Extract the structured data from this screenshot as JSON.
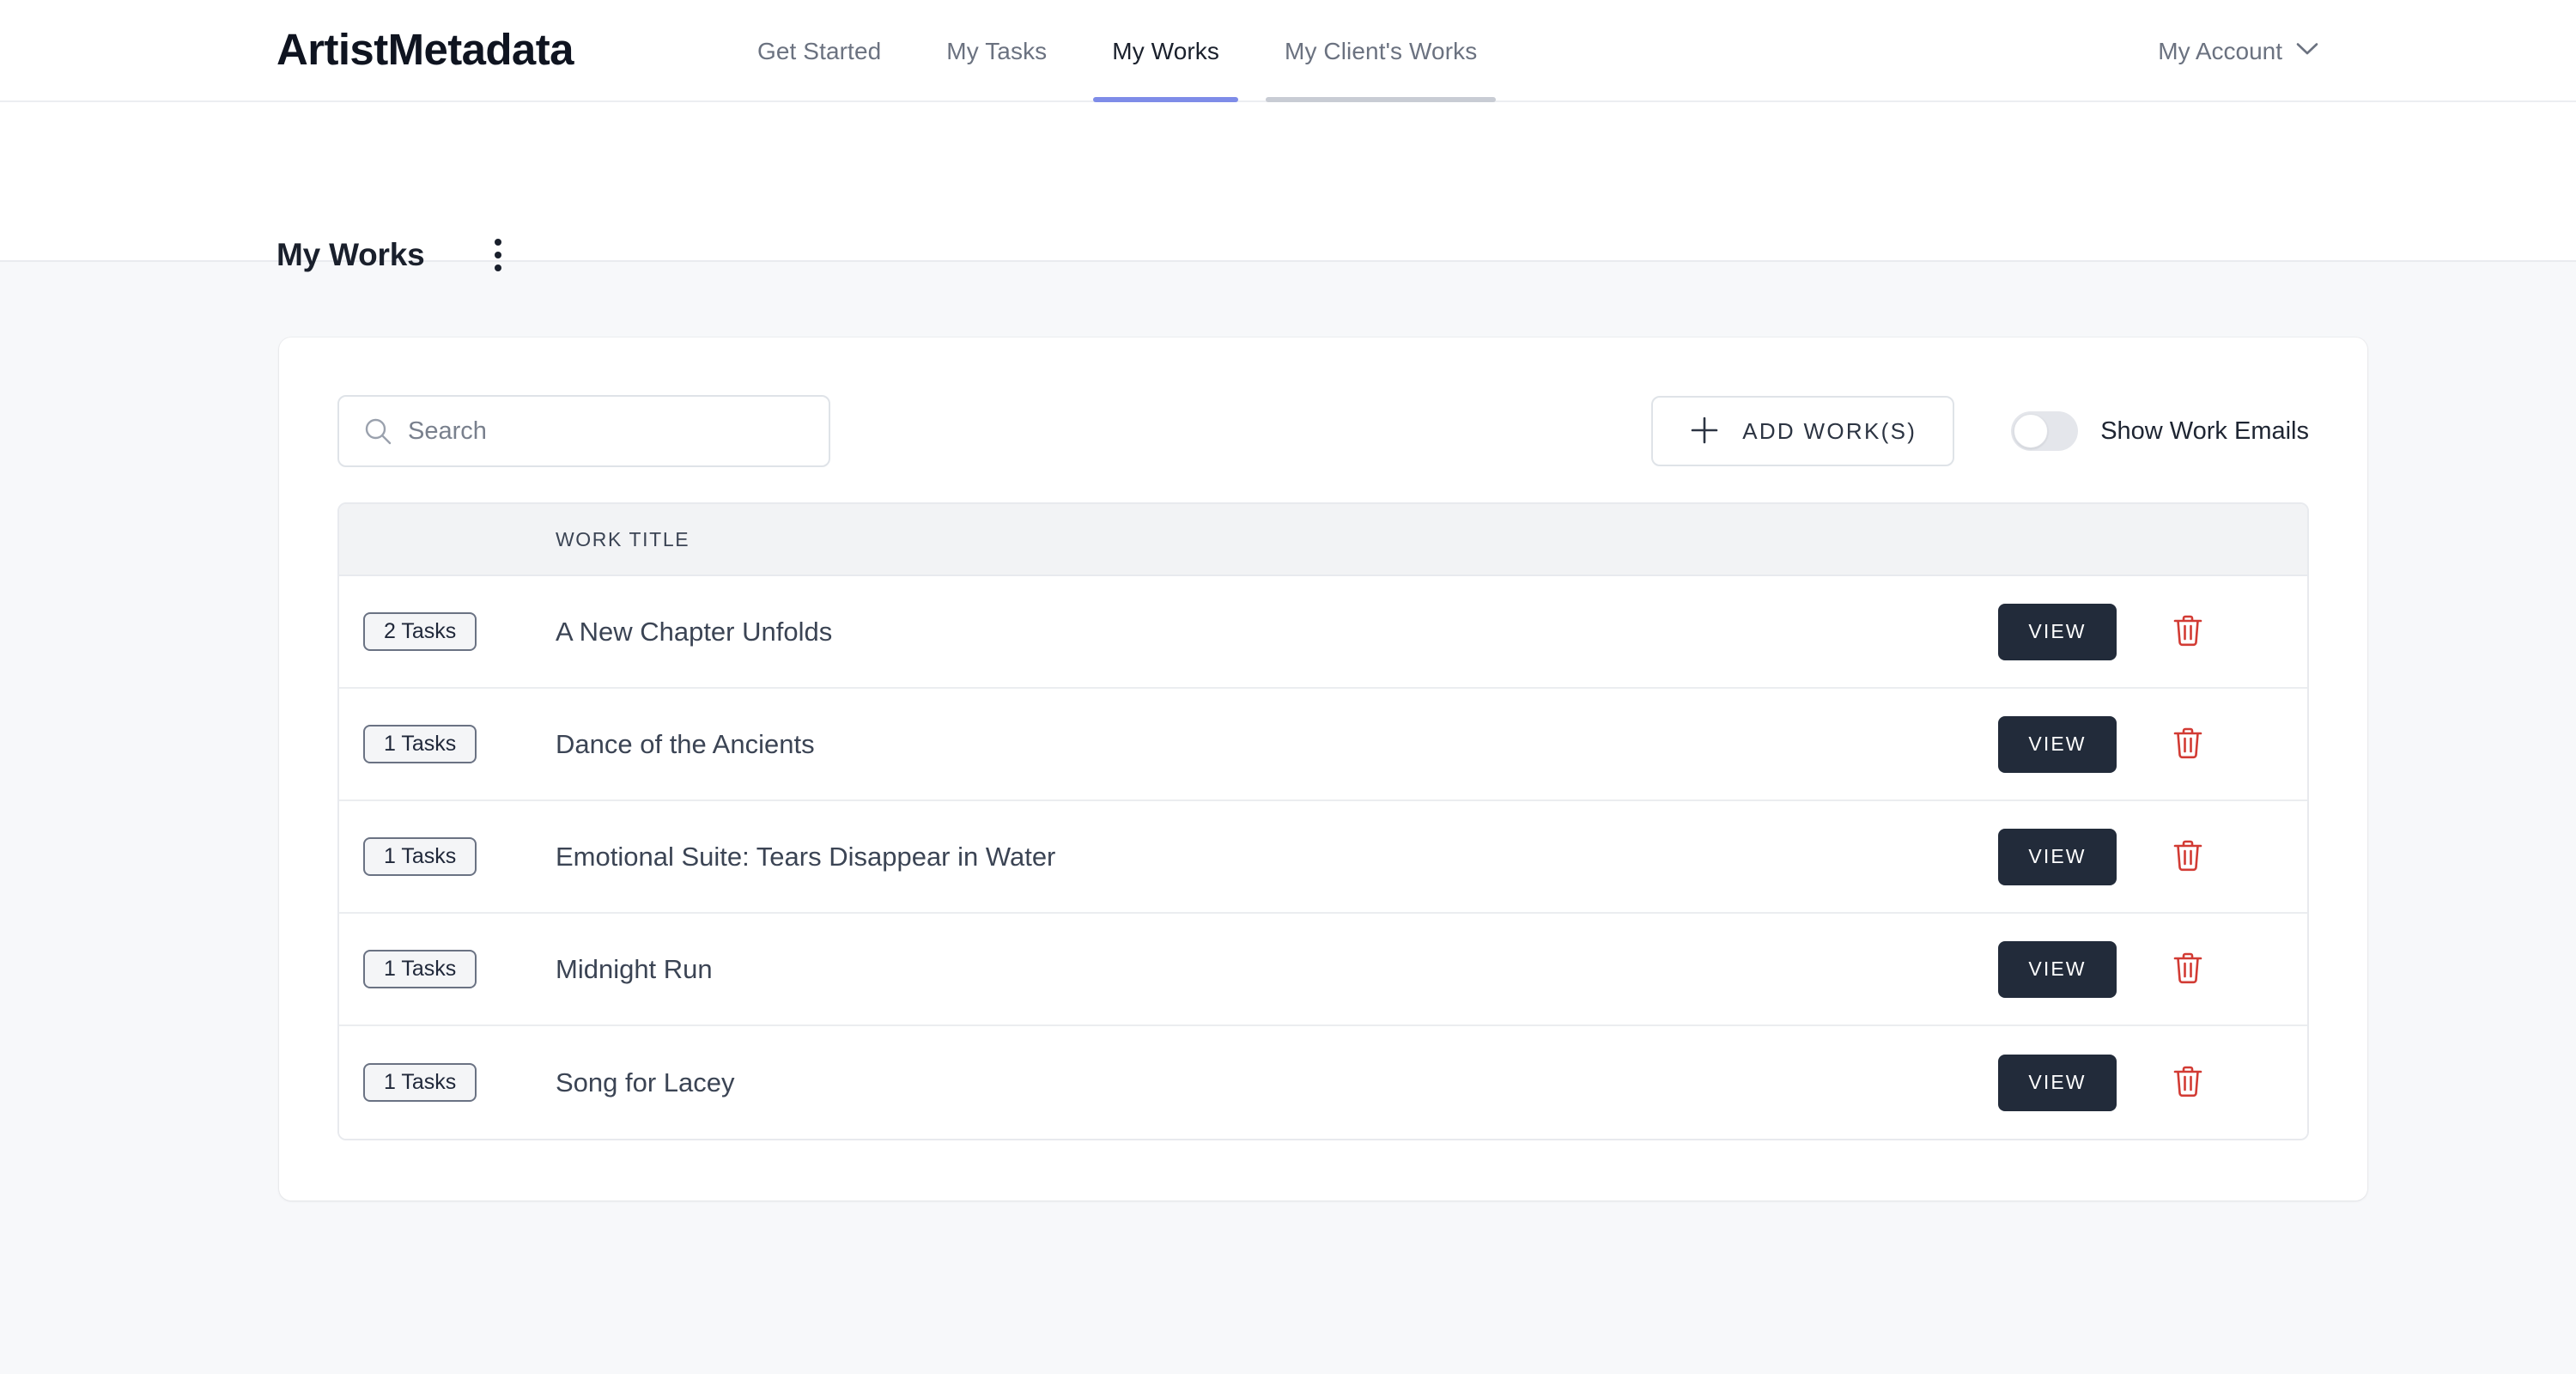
{
  "header": {
    "logo": "ArtistMetadata",
    "tabs": [
      {
        "label": "Get Started",
        "state": "inactive"
      },
      {
        "label": "My Tasks",
        "state": "inactive"
      },
      {
        "label": "My Works",
        "state": "active"
      },
      {
        "label": "My Client's Works",
        "state": "neutral"
      }
    ],
    "account_label": "My Account",
    "account_icon": "chevron-down-icon"
  },
  "page": {
    "title": "My Works",
    "menu_icon": "kebab-menu-icon"
  },
  "toolbar": {
    "search_placeholder": "Search",
    "search_value": "",
    "search_icon": "search-icon",
    "add_button_label": "ADD WORK(S)",
    "add_button_icon": "plus-icon",
    "toggle_label": "Show Work Emails",
    "toggle_state": "off"
  },
  "table": {
    "columns": [
      "",
      "WORK TITLE",
      ""
    ],
    "header_work_title": "WORK TITLE",
    "view_label": "VIEW",
    "delete_icon": "trash-icon",
    "rows": [
      {
        "tasks": "2 Tasks",
        "title": "A New Chapter Unfolds"
      },
      {
        "tasks": "1 Tasks",
        "title": "Dance of the Ancients"
      },
      {
        "tasks": "1 Tasks",
        "title": "Emotional Suite: Tears Disappear in Water"
      },
      {
        "tasks": "1 Tasks",
        "title": "Midnight Run"
      },
      {
        "tasks": "1 Tasks",
        "title": "Song for Lacey"
      }
    ]
  },
  "colors": {
    "accent_active_tab": "#7e8ce8",
    "neutral_tab": "#c8ccd4",
    "view_button": "#222b3a",
    "delete_icon": "#d23b34",
    "page_background": "#f7f8fa"
  }
}
